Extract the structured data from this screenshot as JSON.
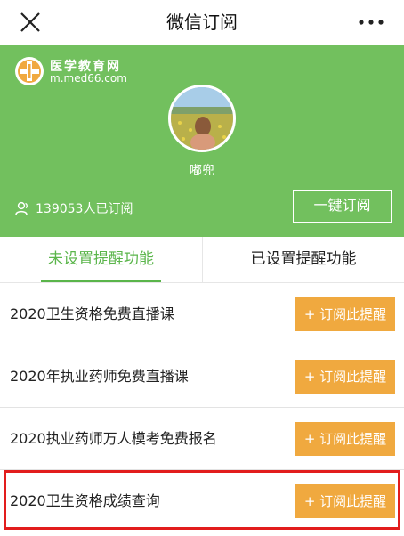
{
  "header": {
    "title": "微信订阅",
    "close_icon": "close-icon",
    "more_icon": "more-icon"
  },
  "banner": {
    "background": "#72c05e",
    "logo": {
      "name_cn": "医学教育网",
      "url": "m.med66.com",
      "accent": "#f0a93f"
    },
    "nickname": "嘟兜",
    "subscribers": "139053人已订阅",
    "subscribe_all": "一键订阅"
  },
  "tabs": [
    {
      "label": "未设置提醒功能",
      "active": true
    },
    {
      "label": "已设置提醒功能",
      "active": false
    }
  ],
  "items": [
    {
      "name": "2020卫生资格免费直播课",
      "action": "+ 订阅此提醒"
    },
    {
      "name": "2020年执业药师免费直播课",
      "action": "+ 订阅此提醒"
    },
    {
      "name": "2020执业药师万人模考免费报名",
      "action": "+ 订阅此提醒"
    },
    {
      "name": "2020卫生资格成绩查询",
      "action": "+ 订阅此提醒",
      "highlighted": true
    }
  ],
  "colors": {
    "primary_green": "#5ab54a",
    "button_orange": "#f0a93f",
    "highlight_red": "#e21d1d"
  }
}
